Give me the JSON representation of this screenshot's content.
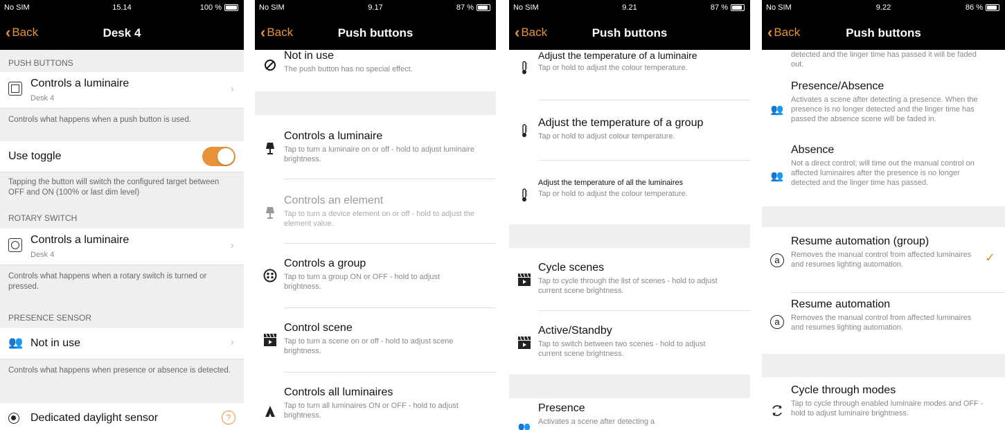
{
  "accent": "#e8923a",
  "screen1": {
    "status": {
      "carrier": "No SIM",
      "time": "15.14",
      "battery": "100 %"
    },
    "back_label": "Back",
    "title": "Desk 4",
    "push_header": "PUSH BUTTONS",
    "push_title": "Controls a luminaire",
    "push_sub": "Desk 4",
    "push_footer": "Controls what happens when a push button is used.",
    "toggle_label": "Use toggle",
    "toggle_on": true,
    "toggle_footer": "Tapping the button will switch the configured target between OFF and ON (100% or last dim level)",
    "rotary_header": "ROTARY SWITCH",
    "rotary_title": "Controls a luminaire",
    "rotary_sub": "Desk 4",
    "rotary_footer": "Controls what happens when a rotary switch is turned or pressed.",
    "presence_header": "PRESENCE SENSOR",
    "presence_title": "Not in use",
    "presence_footer": "Controls what happens when presence or absence is detected.",
    "daylight_title": "Dedicated daylight sensor"
  },
  "screen2": {
    "status": {
      "carrier": "No SIM",
      "time": "9.17",
      "battery": "87 %"
    },
    "back_label": "Back",
    "title": "Push buttons",
    "options": [
      {
        "title": "Not in use",
        "desc": "The push button has no special effect.",
        "icon": "prohibited-icon"
      },
      {
        "title": "Controls a luminaire",
        "desc": "Tap to turn a luminaire on or off - hold to adjust luminaire brightness.",
        "icon": "luminaire-icon"
      },
      {
        "title": "Controls an element",
        "desc": "Tap to turn a device element on or off - hold to adjust the element value.",
        "icon": "element-icon"
      },
      {
        "title": "Controls a group",
        "desc": "Tap to turn a group ON or OFF - hold to adjust brightness.",
        "icon": "group-icon"
      },
      {
        "title": "Control scene",
        "desc": "Tap to turn a scene on or off - hold to adjust scene brightness.",
        "icon": "scene-icon"
      },
      {
        "title": "Controls all luminaires",
        "desc": "Tap to turn all luminaires ON or OFF - hold to adjust brightness.",
        "icon": "all-luminaires-icon"
      }
    ]
  },
  "screen3": {
    "status": {
      "carrier": "No SIM",
      "time": "9.21",
      "battery": "87 %"
    },
    "back_label": "Back",
    "title": "Push buttons",
    "options": [
      {
        "title": "Adjust the temperature of a luminaire",
        "desc": "Tap or hold to adjust the colour temperature.",
        "icon": "thermometer-icon"
      },
      {
        "title": "Adjust the temperature of a group",
        "desc": "Tap or hold to adjust colour temperature.",
        "icon": "thermometer-icon"
      },
      {
        "title": "Adjust the temperature of all the luminaires",
        "desc": "Tap or hold to adjust the colour temperature.",
        "icon": "thermometer-icon"
      },
      {
        "title": "Cycle scenes",
        "desc": "Tap to cycle through the list of scenes - hold to adjust current scene brightness.",
        "icon": "scene-icon"
      },
      {
        "title": "Active/Standby",
        "desc": "Tap to switch between two scenes - hold to adjust current scene brightness.",
        "icon": "scene-icon"
      },
      {
        "title": "Presence",
        "desc": "Activates a scene after detecting a",
        "icon": "presence-icon"
      }
    ]
  },
  "screen4": {
    "status": {
      "carrier": "No SIM",
      "time": "9.22",
      "battery": "86 %"
    },
    "back_label": "Back",
    "title": "Push buttons",
    "options": [
      {
        "title": "",
        "desc": "detected and the linger time has passed it will be faded out.",
        "icon": "presence-icon"
      },
      {
        "title": "Presence/Absence",
        "desc": "Activates a scene after detecting a presence. When the presence is no longer detected and the linger time has passed the absence scene will be faded in.",
        "icon": "presence-icon"
      },
      {
        "title": "Absence",
        "desc": "Not a direct control; will time out the manual control on affected luminaires after the presence is no longer detected and the linger time has passed.",
        "icon": "absence-icon"
      },
      {
        "title": "Resume automation (group)",
        "desc": "Removes the manual control from affected luminaires and resumes lighting automation.",
        "icon": "automation-icon",
        "selected": true
      },
      {
        "title": "Resume automation",
        "desc": "Removes the manual control from affected luminaires and resumes lighting automation.",
        "icon": "automation-icon"
      },
      {
        "title": "Cycle through modes",
        "desc": "Tap to cycle through enabled luminaire modes and OFF - hold to adjust luminaire brightness.",
        "icon": "cycle-icon"
      }
    ],
    "checkmark": "✓"
  }
}
